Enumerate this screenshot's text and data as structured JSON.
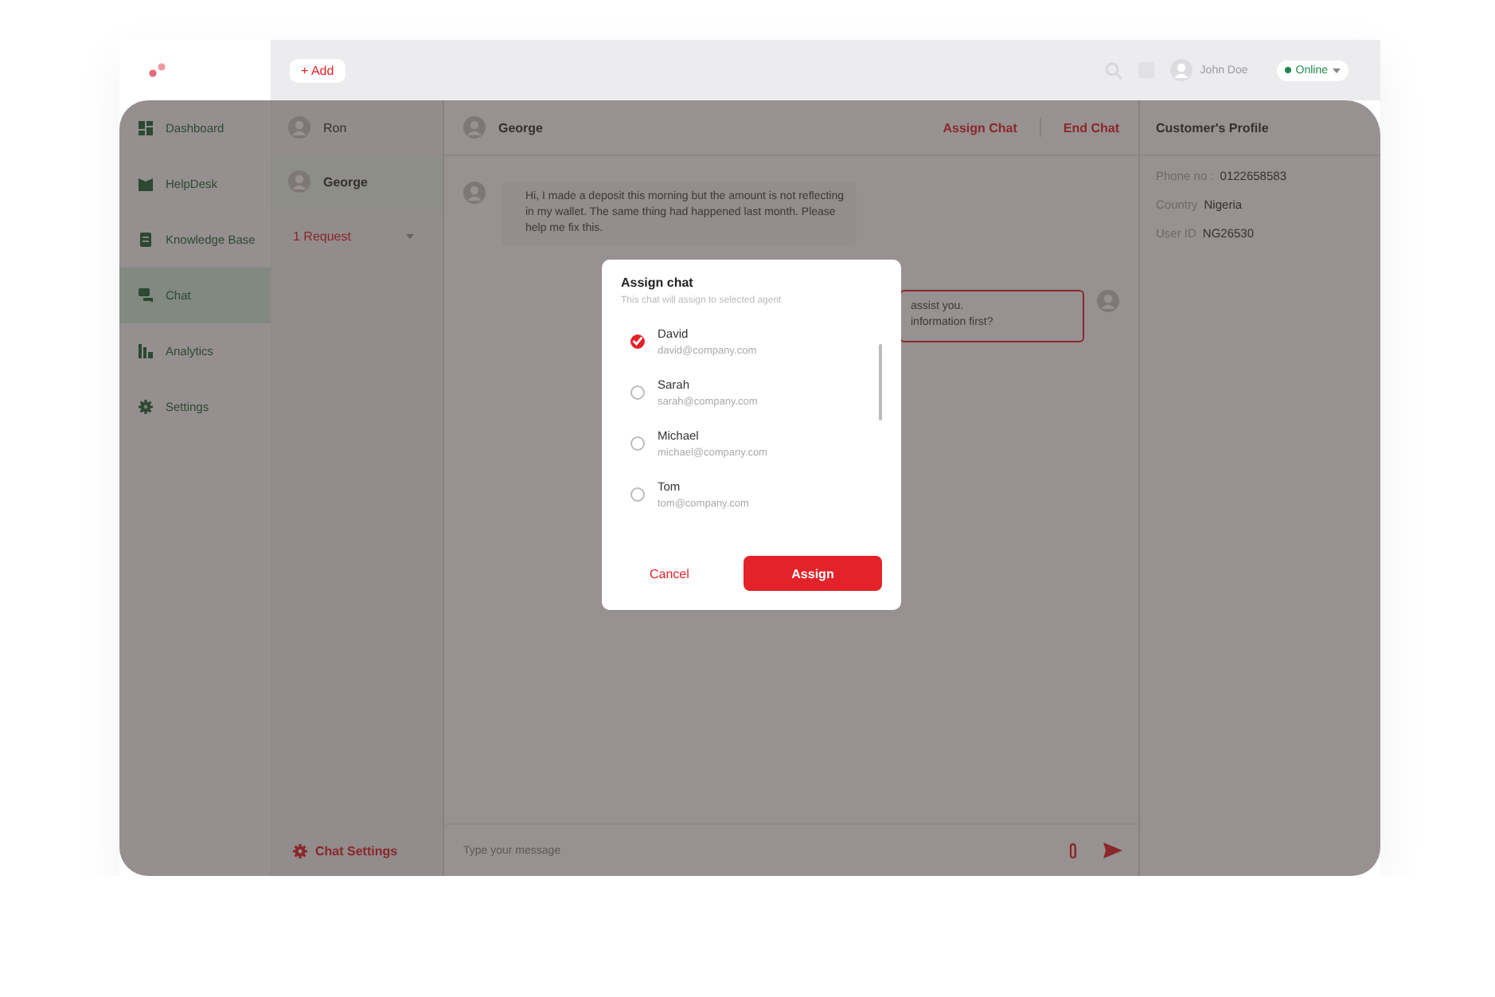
{
  "top_bar": {
    "add_button": "+ Add",
    "user_name": "John Doe",
    "status": {
      "label": "Online",
      "online": true
    }
  },
  "nav": [
    {
      "label": "Dashboard",
      "kind": "grid",
      "selected": false
    },
    {
      "label": "HelpDesk",
      "kind": "book",
      "selected": false
    },
    {
      "label": "Knowledge Base",
      "kind": "doc",
      "selected": false
    },
    {
      "label": "Chat",
      "kind": "chat",
      "selected": true
    },
    {
      "label": "Analytics",
      "kind": "bars",
      "selected": false
    },
    {
      "label": "Settings",
      "kind": "gear",
      "selected": false
    }
  ],
  "chat_list": {
    "items": [
      {
        "name": "Ron",
        "selected": false
      },
      {
        "name": "George",
        "selected": true
      }
    ],
    "requests": "1 Request",
    "settings": "Chat Settings"
  },
  "conversation": {
    "contact": "George",
    "actions": [
      "Assign Chat",
      "End Chat"
    ],
    "messages": [
      {
        "kind": "customer",
        "text": "Hi, I made a deposit this morning but the amount is not reflecting in my wallet. The same thing had happened last month. Please help me fix this."
      },
      {
        "kind": "agent",
        "lines": [
          "assist you.",
          "information first?"
        ]
      }
    ],
    "composer_placeholder": "Type your message"
  },
  "profile": {
    "title": "Customer's Profile",
    "fields": [
      {
        "label": "Phone no :",
        "value": "0122658583"
      },
      {
        "label": "Country",
        "value": "Nigeria"
      },
      {
        "label": "User ID",
        "value": "NG26530"
      }
    ]
  },
  "modal": {
    "title": "Assign chat",
    "subtitle": "This chat will assign to selected agent",
    "agents": [
      {
        "name": "David",
        "email": "david@company.com",
        "selected": true
      },
      {
        "name": "Sarah",
        "email": "sarah@company.com",
        "selected": false
      },
      {
        "name": "Michael",
        "email": "michael@company.com",
        "selected": false
      },
      {
        "name": "Tom",
        "email": "tom@company.com",
        "selected": false
      }
    ],
    "cancel": "Cancel",
    "confirm": "Assign"
  }
}
